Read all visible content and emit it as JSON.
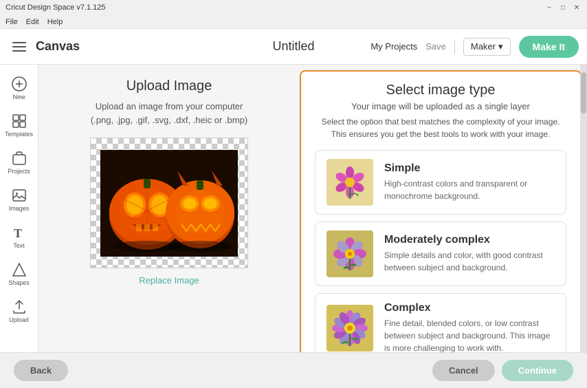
{
  "titleBar": {
    "appName": "Cricut Design Space v7.1.125",
    "controls": {
      "minimize": "−",
      "maximize": "□",
      "close": "✕"
    }
  },
  "menuBar": {
    "items": [
      "File",
      "Edit",
      "Help"
    ]
  },
  "appBar": {
    "hamburger": "☰",
    "canvasLabel": "Canvas",
    "title": "Untitled",
    "myProjects": "My Projects",
    "save": "Save",
    "divider": "|",
    "maker": "Maker",
    "makeIt": "Make It"
  },
  "sidebar": {
    "items": [
      {
        "id": "new",
        "label": "New",
        "icon": "+"
      },
      {
        "id": "templates",
        "label": "Templates",
        "icon": "▦"
      },
      {
        "id": "projects",
        "label": "Projects",
        "icon": "⊞"
      },
      {
        "id": "images",
        "label": "Images",
        "icon": "🖼"
      },
      {
        "id": "text",
        "label": "Text",
        "icon": "T"
      },
      {
        "id": "shapes",
        "label": "Shapes",
        "icon": "◇"
      },
      {
        "id": "upload",
        "label": "Upload",
        "icon": "↑"
      }
    ]
  },
  "uploadPanel": {
    "title": "Upload Image",
    "subtitle1": "Upload an image from your computer",
    "subtitle2": "(.png, .jpg, .gif, .svg, .dxf, .heic or .bmp)",
    "replaceLink": "Replace Image"
  },
  "selectPanel": {
    "title": "Select image type",
    "subtitle": "Your image will be uploaded as a single layer",
    "instruction": "Select the option that best matches the complexity of your image.\nThis ensures you get the best tools to work with your image.",
    "imageTypes": [
      {
        "id": "simple",
        "title": "Simple",
        "description": "High-contrast colors and transparent or monochrome background.",
        "selected": false
      },
      {
        "id": "moderately-complex",
        "title": "Moderately complex",
        "description": "Simple details and color, with good contrast between subject and background.",
        "selected": false
      },
      {
        "id": "complex",
        "title": "Complex",
        "description": "Fine detail, blended colors, or low contrast between subject and background. This image is more challenging to work with.",
        "selected": false
      }
    ]
  },
  "bottomBar": {
    "back": "Back",
    "cancel": "Cancel",
    "continue": "Continue"
  }
}
